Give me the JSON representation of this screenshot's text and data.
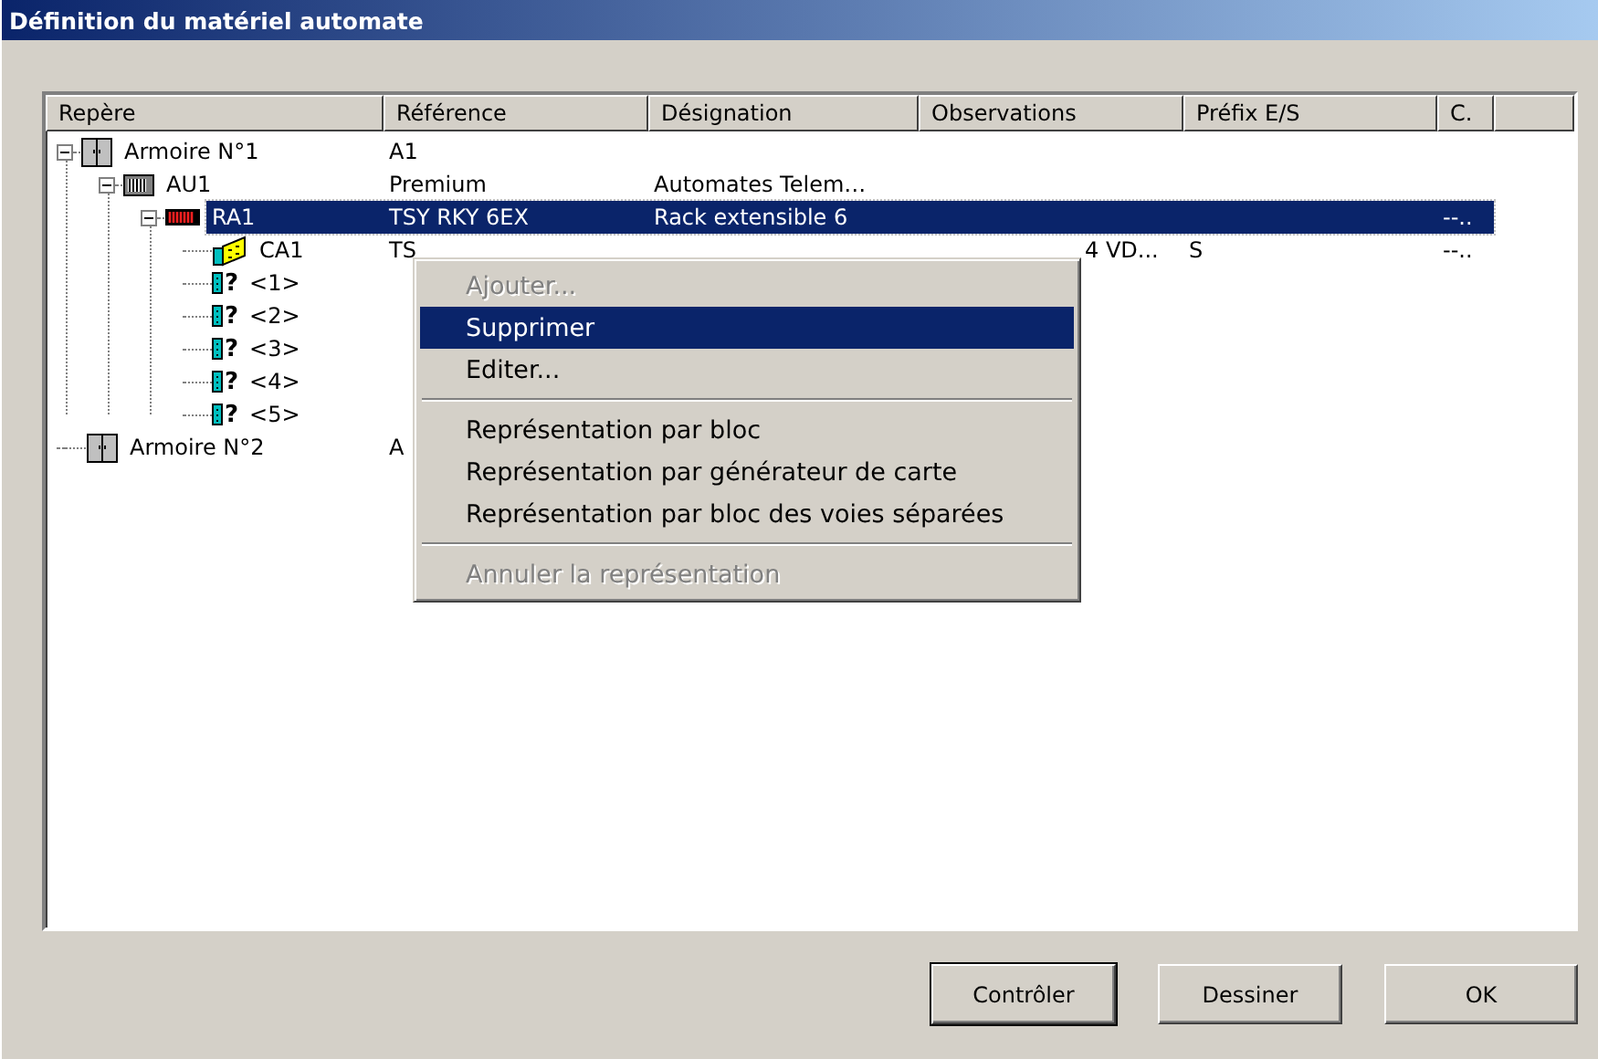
{
  "window": {
    "title": "Définition du matériel automate"
  },
  "table": {
    "columns": [
      "Repère",
      "Référence",
      "Désignation",
      "Observations",
      "Préfix E/S",
      "C."
    ],
    "rows": [
      {
        "kind": "cabinet",
        "label": "Armoire N°1",
        "cells": [
          "A1",
          "",
          "",
          "",
          ""
        ],
        "expanded": true,
        "selected": false,
        "children": [
          {
            "kind": "plc",
            "label": "AU1",
            "cells": [
              "Premium",
              "Automates Telem…",
              "",
              "",
              ""
            ],
            "expanded": true,
            "selected": false,
            "children": [
              {
                "kind": "rack",
                "label": "RA1",
                "cells": [
                  "TSY RKY 6EX",
                  "Rack extensible 6",
                  "",
                  "",
                  "--.."
                ],
                "expanded": true,
                "selected": true,
                "children": [
                  {
                    "kind": "card",
                    "label": "CA1",
                    "cells": [
                      "TS",
                      "",
                      "4 VD...",
                      "S",
                      "--.."
                    ],
                    "selected": false
                  },
                  {
                    "kind": "slot",
                    "glyph": "?",
                    "label": "<1>",
                    "cells": [
                      "",
                      "",
                      "",
                      "",
                      ""
                    ],
                    "selected": false
                  },
                  {
                    "kind": "slot",
                    "glyph": "?",
                    "label": "<2>",
                    "cells": [
                      "",
                      "",
                      "",
                      "",
                      ""
                    ],
                    "selected": false
                  },
                  {
                    "kind": "slot",
                    "glyph": "?",
                    "label": "<3>",
                    "cells": [
                      "",
                      "",
                      "",
                      "",
                      ""
                    ],
                    "selected": false
                  },
                  {
                    "kind": "slot",
                    "glyph": "?",
                    "label": "<4>",
                    "cells": [
                      "",
                      "",
                      "",
                      "",
                      ""
                    ],
                    "selected": false
                  },
                  {
                    "kind": "slot",
                    "glyph": "?",
                    "label": "<5>",
                    "cells": [
                      "",
                      "",
                      "",
                      "",
                      ""
                    ],
                    "selected": false
                  }
                ]
              }
            ]
          }
        ]
      },
      {
        "kind": "cabinet",
        "label": "Armoire N°2",
        "cells": [
          "A",
          "",
          "",
          "",
          ""
        ],
        "selected": false
      }
    ]
  },
  "context_menu": {
    "items": [
      {
        "kind": "item",
        "label": "Ajouter...",
        "disabled": true,
        "selected": false
      },
      {
        "kind": "item",
        "label": "Supprimer",
        "disabled": false,
        "selected": true
      },
      {
        "kind": "item",
        "label": "Editer...",
        "disabled": false,
        "selected": false
      },
      {
        "kind": "separator"
      },
      {
        "kind": "item",
        "label": "Représentation par bloc",
        "disabled": false,
        "selected": false
      },
      {
        "kind": "item",
        "label": "Représentation par générateur de carte",
        "disabled": false,
        "selected": false
      },
      {
        "kind": "item",
        "label": "Représentation par bloc des voies séparées",
        "disabled": false,
        "selected": false
      },
      {
        "kind": "separator"
      },
      {
        "kind": "item",
        "label": "Annuler la représentation",
        "disabled": true,
        "selected": false
      }
    ]
  },
  "buttons": [
    {
      "label": "Contrôler",
      "default": true
    },
    {
      "label": "Dessiner",
      "default": false
    },
    {
      "label": "OK",
      "default": false
    }
  ]
}
